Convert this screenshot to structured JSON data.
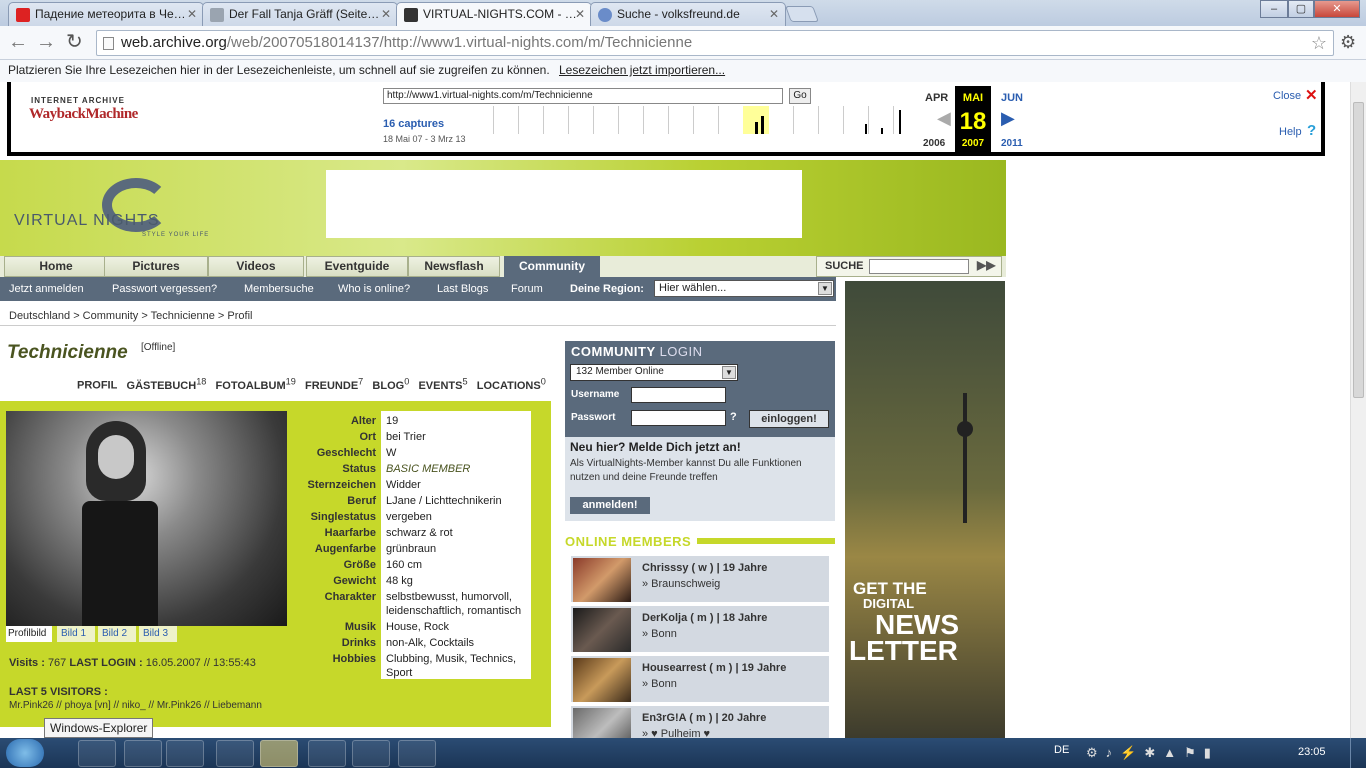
{
  "browser": {
    "tabs": [
      {
        "title": "Падение метеорита в Че…",
        "icon": "youtube-icon"
      },
      {
        "title": "Der Fall Tanja Gräff (Seite…",
        "icon": "page-icon"
      },
      {
        "title": "VIRTUAL-NIGHTS.COM - …",
        "icon": "archive-icon"
      },
      {
        "title": "Suche - volksfreund.de",
        "icon": "de-icon"
      }
    ],
    "url_host": "web.archive.org",
    "url_path": "/web/20070518014137/http://www1.virtual-nights.com/m/Technicienne",
    "bookmarks_text": "Platzieren Sie Ihre Lesezeichen hier in der Lesezeichenleiste, um schnell auf sie zugreifen zu können.",
    "bookmarks_link": "Lesezeichen jetzt importieren..."
  },
  "wayback": {
    "logo_top": "INTERNET ARCHIVE",
    "logo_main": "WaybackMachine",
    "url_value": "http://www1.virtual-nights.com/m/Technicienne",
    "go": "Go",
    "captures": "16 captures",
    "range": "18 Mai 07 - 3 Mrz 13",
    "prev_month": "APR",
    "cur_month": "MAI",
    "next_month": "JUN",
    "day": "18",
    "prev_year": "2006",
    "cur_year": "2007",
    "next_year": "2011",
    "close": "Close"
  },
  "site": {
    "logo": "VIRTUAL NIGHTS",
    "tagline": "STYLE YOUR LIFE",
    "nav": [
      "Home",
      "Pictures",
      "Videos",
      "Eventguide",
      "Newsflash",
      "Community"
    ],
    "search_label": "SUCHE",
    "subnav": [
      "Jetzt anmelden",
      "Passwort vergessen?",
      "Membersuche",
      "Who is online?",
      "Last Blogs",
      "Forum"
    ],
    "region_label": "Deine Region:",
    "region_value": "Hier wählen...",
    "breadcrumb": "Deutschland  >  Community  >  Technicienne  >  Profil"
  },
  "profile": {
    "name": "Technicienne",
    "status_tag": "[Offline]",
    "tabs": [
      {
        "label": "PROFIL",
        "count": ""
      },
      {
        "label": "GÄSTEBUCH",
        "count": "18"
      },
      {
        "label": "FOTOALBUM",
        "count": "19"
      },
      {
        "label": "FREUNDE",
        "count": "7"
      },
      {
        "label": "BLOG",
        "count": "0"
      },
      {
        "label": "EVENTS",
        "count": "5"
      },
      {
        "label": "LOCATIONS",
        "count": "0"
      }
    ],
    "photo_tabs": [
      "Profilbild",
      "Bild 1",
      "Bild 2",
      "Bild 3"
    ],
    "fields": [
      {
        "k": "Alter",
        "v": "19"
      },
      {
        "k": "Ort",
        "v": "bei Trier"
      },
      {
        "k": "Geschlecht",
        "v": "W"
      },
      {
        "k": "Status",
        "v": "BASIC MEMBER"
      },
      {
        "k": "Sternzeichen",
        "v": "Widder"
      },
      {
        "k": "Beruf",
        "v": "LJane / Lichttechnikerin"
      },
      {
        "k": "Singlestatus",
        "v": "vergeben"
      },
      {
        "k": "Haarfarbe",
        "v": "schwarz & rot"
      },
      {
        "k": "Augenfarbe",
        "v": "grünbraun"
      },
      {
        "k": "Größe",
        "v": "160 cm"
      },
      {
        "k": "Gewicht",
        "v": "48 kg"
      },
      {
        "k": "Charakter",
        "v": "selbstbewusst, humorvoll,",
        "v2": "leidenschaftlich, romantisch"
      },
      {
        "k": "Musik",
        "v": "House, Rock"
      },
      {
        "k": "Drinks",
        "v": "non-Alk, Cocktails"
      },
      {
        "k": "Hobbies",
        "v": "Clubbing, Musik, Technics,",
        "v2": "Sport"
      }
    ],
    "visits_label": "Visits :",
    "visits_value": "767",
    "last_login_label": "LAST LOGIN :",
    "last_login_value": "16.05.2007 // 13:55:43",
    "last_visitors_label": "LAST 5 VISITORS :",
    "last_visitors": "Mr.Pink26 // phoya [vn] // niko_ // Mr.Pink26 // Liebemann"
  },
  "login": {
    "title_a": "COMMUNITY",
    "title_b": "LOGIN",
    "online_select": "132 Member Online",
    "username_label": "Username",
    "password_label": "Passwort",
    "help": "?",
    "login_button": "einloggen!",
    "new_heading": "Neu hier? Melde Dich jetzt an!",
    "new_text_1": "Als VirtualNights-Member kannst Du alle Funktionen",
    "new_text_2": "nutzen und deine Freunde treffen",
    "register_button": "anmelden!"
  },
  "online_members": {
    "title": "ONLINE MEMBERS",
    "members": [
      {
        "name": "Chrisssy ( w ) | 19 Jahre",
        "city": "» Braunschweig"
      },
      {
        "name": "DerKolja ( m ) | 18 Jahre",
        "city": "» Bonn"
      },
      {
        "name": "Housearrest ( m ) | 19 Jahre",
        "city": "» Bonn"
      },
      {
        "name": "En3rG!A ( m ) | 20 Jahre",
        "city": "» ♥ Pulheim ♥"
      }
    ]
  },
  "banner": {
    "line1": "GET THE",
    "line2": "DIGITAL",
    "line3": "NEWS",
    "line4": "LETTER"
  },
  "taskbar": {
    "tooltip": "Windows-Explorer",
    "lang": "DE",
    "clock": "23:05"
  }
}
